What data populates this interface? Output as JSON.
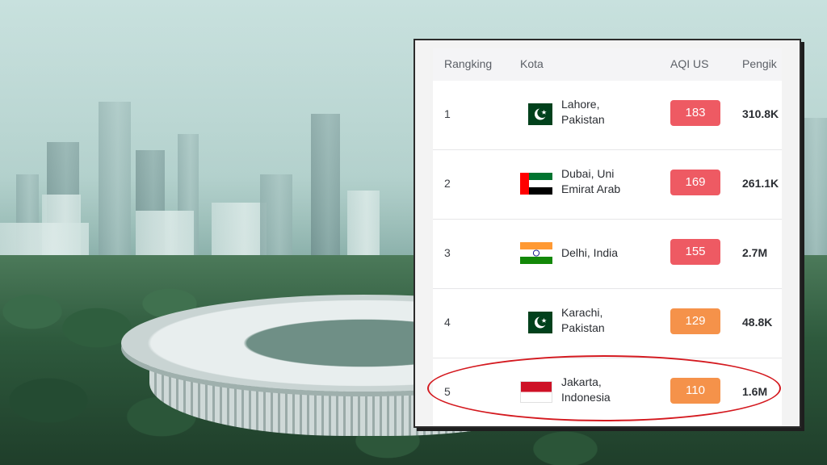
{
  "table": {
    "headers": {
      "rank": "Rangking",
      "city": "Kota",
      "aqi": "AQI US",
      "followers": "Pengik"
    },
    "rows": [
      {
        "rank": "1",
        "city_line1": "Lahore,",
        "city_line2": "Pakistan",
        "flag": "pakistan-flag",
        "aqi": "183",
        "aqi_color": "#ee5a63",
        "followers": "310.8K"
      },
      {
        "rank": "2",
        "city_line1": "Dubai, Uni",
        "city_line2": "Emirat Arab",
        "flag": "uae-flag",
        "aqi": "169",
        "aqi_color": "#ee5a63",
        "followers": "261.1K"
      },
      {
        "rank": "3",
        "city_line1": "Delhi, India",
        "city_line2": "",
        "flag": "india-flag",
        "aqi": "155",
        "aqi_color": "#ee5a63",
        "followers": "2.7M"
      },
      {
        "rank": "4",
        "city_line1": "Karachi,",
        "city_line2": "Pakistan",
        "flag": "pakistan-flag",
        "aqi": "129",
        "aqi_color": "#f5924a",
        "followers": "48.8K"
      },
      {
        "rank": "5",
        "city_line1": "Jakarta,",
        "city_line2": "Indonesia",
        "flag": "indonesia-flag",
        "aqi": "110",
        "aqi_color": "#f5924a",
        "followers": "1.6M"
      }
    ]
  },
  "colors": {
    "unhealthy": "#ee5a63",
    "sensitive": "#f5924a",
    "highlight_ring": "#d4191f"
  }
}
